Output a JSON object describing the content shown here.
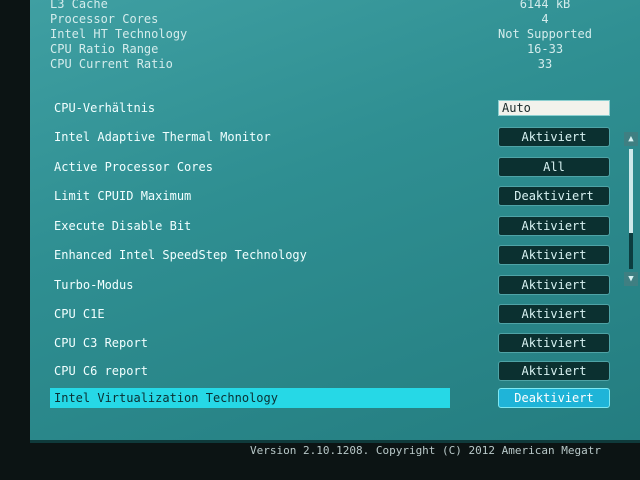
{
  "info": [
    {
      "label": "L3 Cache",
      "value": "6144 kB"
    },
    {
      "label": "Processor Cores",
      "value": "4"
    },
    {
      "label": "Intel HT Technology",
      "value": "Not Supported"
    },
    {
      "label": "CPU Ratio Range",
      "value": "16-33"
    },
    {
      "label": "CPU Current Ratio",
      "value": "33"
    }
  ],
  "settings": [
    {
      "label": "CPU-Verhältnis",
      "value": "Auto",
      "type": "input"
    },
    {
      "label": "Intel Adaptive Thermal Monitor",
      "value": "Aktiviert"
    },
    {
      "label": "Active Processor Cores",
      "value": "All"
    },
    {
      "label": "Limit CPUID Maximum",
      "value": "Deaktiviert"
    },
    {
      "label": "Execute Disable Bit",
      "value": "Aktiviert"
    },
    {
      "label": "Enhanced Intel SpeedStep Technology",
      "value": "Aktiviert"
    },
    {
      "label": "Turbo-Modus",
      "value": "Aktiviert"
    },
    {
      "label": "CPU C1E",
      "value": "Aktiviert"
    },
    {
      "label": "CPU C3 Report",
      "value": "Aktiviert"
    },
    {
      "label": "CPU C6 report",
      "value": "Aktiviert"
    },
    {
      "label": "Intel Virtualization Technology",
      "value": "Deaktiviert",
      "selected": true
    }
  ],
  "scrollbar": {
    "up_icon": "triangle-up",
    "down_icon": "triangle-down",
    "position_fraction": 0.7
  },
  "footer": {
    "text": "Version 2.10.1208. Copyright (C) 2012 American Megatr"
  },
  "colors": {
    "background": "#2f8f92",
    "highlight": "#26d8e6",
    "button": "#0b3030"
  }
}
